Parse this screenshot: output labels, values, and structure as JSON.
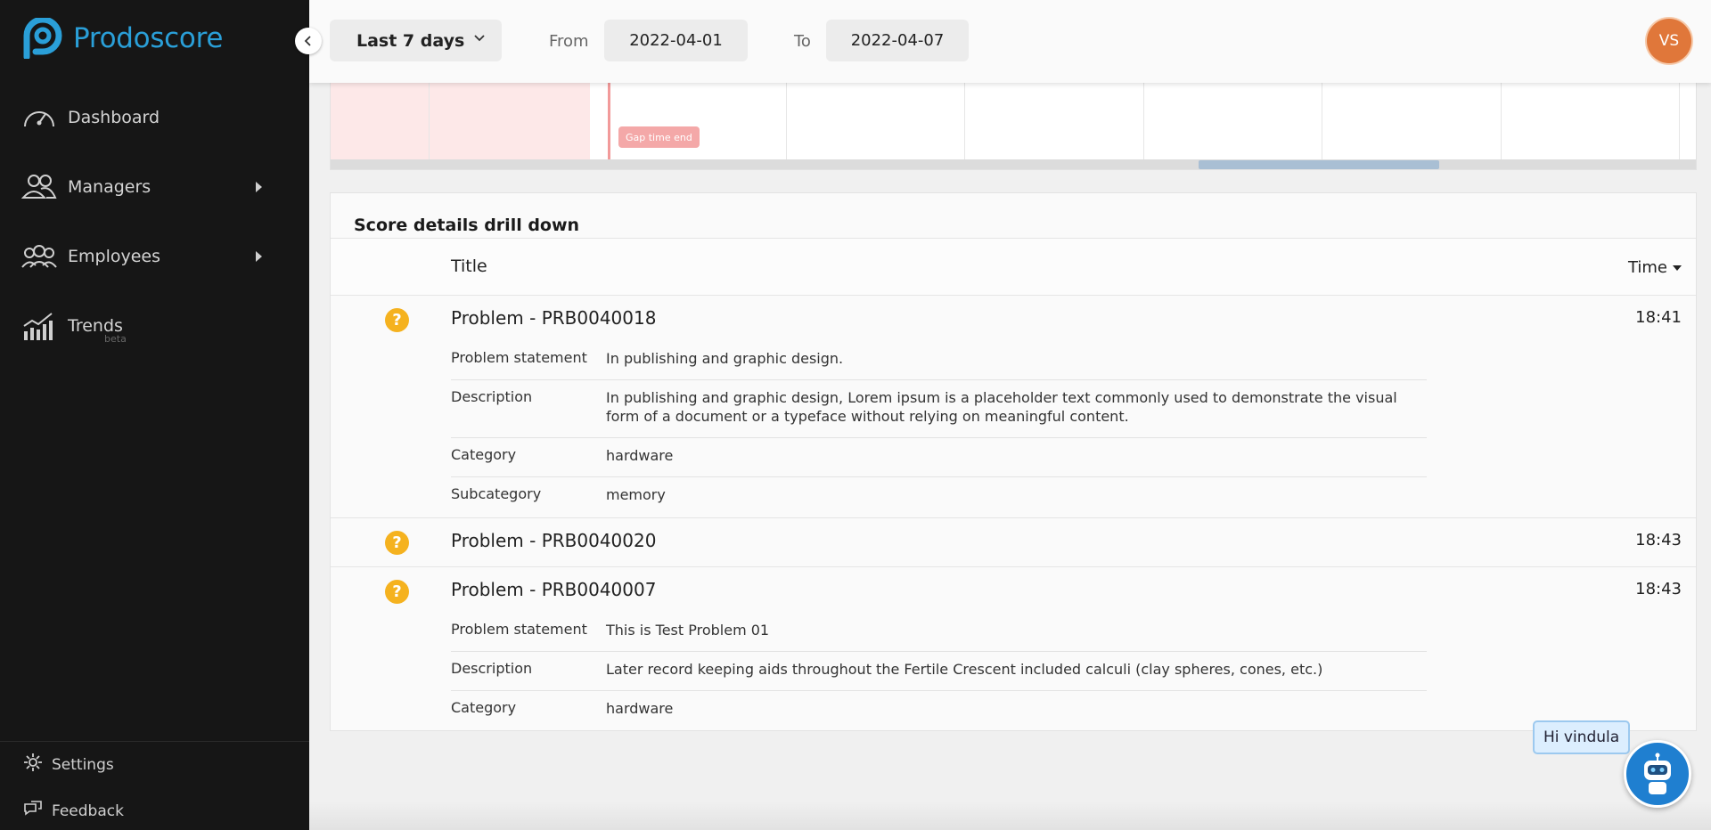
{
  "brand": {
    "name": "Prodoscore",
    "color": "#2a9fd8"
  },
  "sidebar": {
    "items": [
      {
        "label": "Dashboard",
        "icon": "speedometer-icon"
      },
      {
        "label": "Managers",
        "icon": "managers-icon",
        "has_submenu": true
      },
      {
        "label": "Employees",
        "icon": "employees-icon",
        "has_submenu": true
      },
      {
        "label": "Trends",
        "icon": "trends-icon",
        "badge": "beta"
      }
    ],
    "bottom": [
      {
        "label": "Settings",
        "icon": "gear-icon"
      },
      {
        "label": "Feedback",
        "icon": "feedback-icon"
      }
    ]
  },
  "header": {
    "period": "Last 7 days",
    "from_label": "From",
    "from_value": "2022-04-01",
    "to_label": "To",
    "to_value": "2022-04-07",
    "avatar_initials": "VS",
    "avatar_color": "#e0773a"
  },
  "timeline": {
    "gap_badge": "Gap time end"
  },
  "details": {
    "title": "Score details drill down",
    "col_title": "Title",
    "col_time": "Time",
    "problems": [
      {
        "title": "Problem - PRB0040018",
        "time": "18:41",
        "fields": [
          {
            "key": "Problem statement",
            "value": "In publishing and graphic design."
          },
          {
            "key": "Description",
            "value": "In publishing and graphic design, Lorem ipsum is a placeholder text commonly used to demonstrate the visual form of a document or a typeface without relying on meaningful content."
          },
          {
            "key": "Category",
            "value": "hardware"
          },
          {
            "key": "Subcategory",
            "value": "memory"
          }
        ]
      },
      {
        "title": "Problem - PRB0040020",
        "time": "18:43",
        "fields": []
      },
      {
        "title": "Problem - PRB0040007",
        "time": "18:43",
        "fields": [
          {
            "key": "Problem statement",
            "value": "This is Test Problem 01"
          },
          {
            "key": "Description",
            "value": "Later record keeping aids throughout the Fertile Crescent included calculi (clay spheres, cones, etc.)"
          },
          {
            "key": "Category",
            "value": "hardware"
          }
        ]
      }
    ]
  },
  "chat": {
    "greeting": "Hi vindula"
  }
}
